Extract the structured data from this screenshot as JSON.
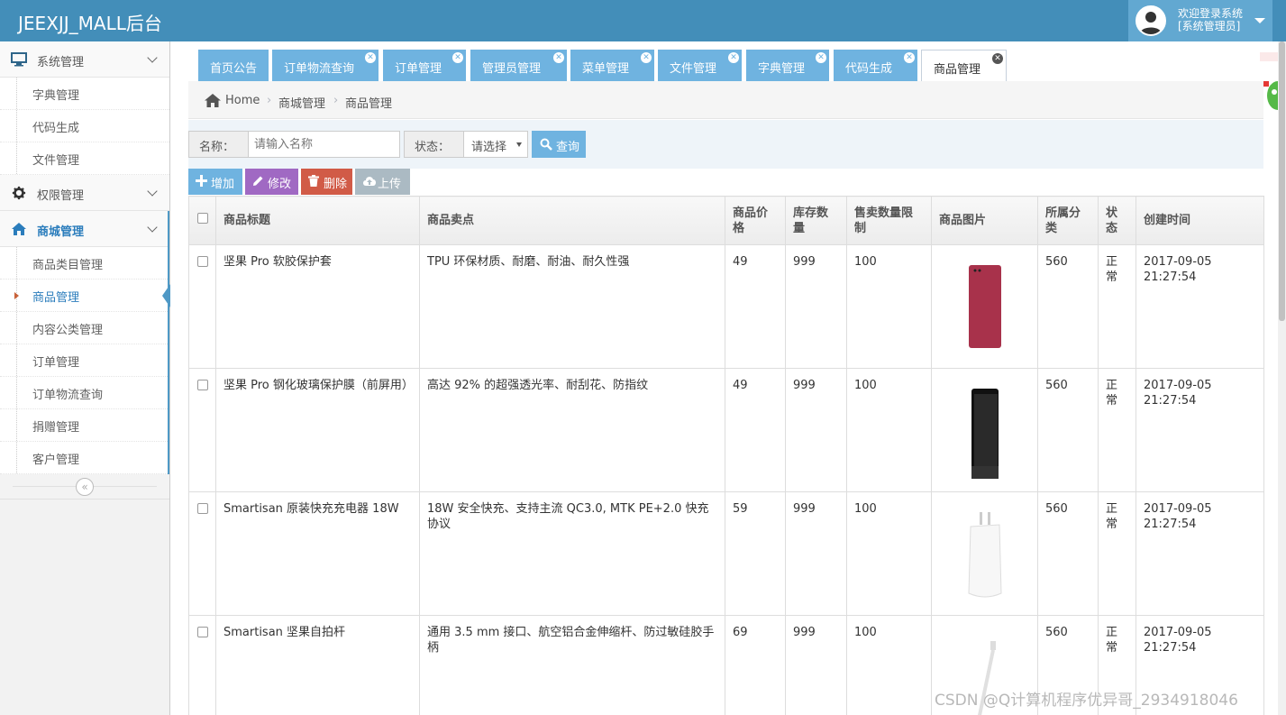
{
  "app": {
    "title": "JEEXJJ_MALL后台"
  },
  "user": {
    "greeting": "欢迎登录系统",
    "role": "[系统管理员]"
  },
  "sidebar": {
    "groups": [
      {
        "label": "系统管理",
        "icon": "desktop-icon",
        "items": [
          "字典管理",
          "代码生成",
          "文件管理"
        ]
      },
      {
        "label": "权限管理",
        "icon": "gear-icon",
        "items": []
      },
      {
        "label": "商城管理",
        "icon": "home-icon",
        "items": [
          "商品类目管理",
          "商品管理",
          "内容公类管理",
          "订单管理",
          "订单物流查询",
          "捐赠管理",
          "客户管理"
        ]
      }
    ],
    "current_item": "商品管理",
    "collapse_icon": "«"
  },
  "tabs": [
    {
      "label": "首页公告",
      "closable": false
    },
    {
      "label": "订单物流查询",
      "closable": true
    },
    {
      "label": "订单管理",
      "closable": true
    },
    {
      "label": "管理员管理",
      "closable": true
    },
    {
      "label": "菜单管理",
      "closable": true
    },
    {
      "label": "文件管理",
      "closable": true
    },
    {
      "label": "字典管理",
      "closable": true
    },
    {
      "label": "代码生成",
      "closable": true
    },
    {
      "label": "商品管理",
      "closable": true,
      "active": true
    }
  ],
  "breadcrumb": [
    "Home",
    "商城管理",
    "商品管理"
  ],
  "search": {
    "name_label": "名称：",
    "name_placeholder": "请输入名称",
    "status_label": "状态：",
    "status_value": "请选择",
    "query_label": "查询"
  },
  "toolbar": {
    "add": "增加",
    "edit": "修改",
    "delete": "删除",
    "upload": "上传"
  },
  "colors": {
    "navbar": "#438eb9",
    "tab": "#6fb3e0",
    "add": "#6fb3e0",
    "edit": "#a069c3",
    "delete": "#d15b47",
    "upload": "#abbac3"
  },
  "table": {
    "headers": [
      "商品标题",
      "商品卖点",
      "商品价格",
      "库存数量",
      "售卖数量限制",
      "商品图片",
      "所属分类",
      "状态",
      "创建时间"
    ],
    "rows": [
      {
        "title": "坚果 Pro 软胶保护套",
        "sell_point": "TPU 环保材质、耐磨、耐油、耐久性强",
        "price": "49",
        "stock": "999",
        "limit": "100",
        "image": "red-phone-case",
        "category": "560",
        "status": "正常",
        "created": "2017-09-05 21:27:54"
      },
      {
        "title": "坚果 Pro 钢化玻璃保护膜（前屏用）",
        "sell_point": "高达 92% 的超强透光率、耐刮花、防指纹",
        "price": "49",
        "stock": "999",
        "limit": "100",
        "image": "black-phone-screen",
        "category": "560",
        "status": "正常",
        "created": "2017-09-05 21:27:54"
      },
      {
        "title": "Smartisan 原装快充充电器 18W",
        "sell_point": "18W 安全快充、支持主流 QC3.0, MTK PE+2.0 快充协议",
        "price": "59",
        "stock": "999",
        "limit": "100",
        "image": "white-charger",
        "category": "560",
        "status": "正常",
        "created": "2017-09-05 21:27:54"
      },
      {
        "title": "Smartisan 坚果自拍杆",
        "sell_point": "通用 3.5 mm 接口、航空铝合金伸缩杆、防过敏硅胶手柄",
        "price": "69",
        "stock": "999",
        "limit": "100",
        "image": "selfie-stick",
        "category": "560",
        "status": "正常",
        "created": "2017-09-05 21:27:54"
      }
    ]
  },
  "watermark": "CSDN @Q计算机程序优异哥_2934918046"
}
